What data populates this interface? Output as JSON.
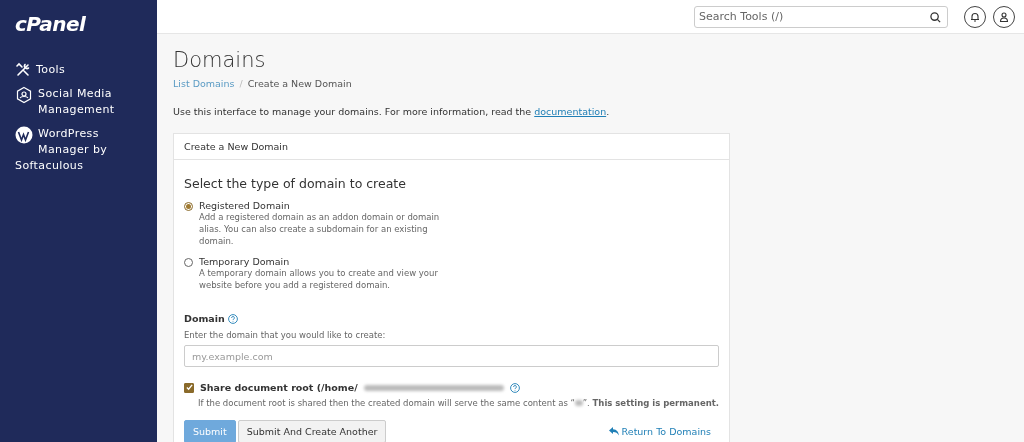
{
  "sidebar": {
    "logo": "cPanel",
    "items": [
      {
        "kind": "tools",
        "label": "Tools"
      },
      {
        "kind": "social",
        "label": "Social Media Management"
      },
      {
        "kind": "wordpress",
        "label": "WordPress Manager by Softaculous"
      }
    ]
  },
  "topbar": {
    "search": {
      "placeholder": "Search Tools (/)"
    }
  },
  "page": {
    "title": "Domains",
    "breadcrumb_separator": "/",
    "breadcrumb": [
      {
        "label": "List Domains",
        "link": true
      },
      {
        "label": "Create a New Domain",
        "link": false
      }
    ],
    "intro": "Use this interface to manage your domains. For more information, read the ",
    "intro_link": "documentation",
    "intro_end": "."
  },
  "panel": {
    "header": "Create a New Domain",
    "heading": "Select the type of domain to create",
    "options": [
      {
        "label": "Registered Domain",
        "description": "Add a registered domain as an addon domain or domain alias. You can also create a subdomain for an existing domain.",
        "selected": true
      },
      {
        "label": "Temporary Domain",
        "description": "A temporary domain allows you to create and view your website before you add a registered domain.",
        "selected": false
      }
    ],
    "domain_label": "Domain",
    "domain_hint": "Enter the domain that you would like to create:",
    "domain_field": {
      "placeholder": "my.example.com"
    },
    "share": {
      "label": "Share document root (/home/",
      "checked": true,
      "help": "If the document root is shared then the created domain will serve the same content as “",
      "help_end": "”. **This setting is permanent.**"
    },
    "buttons": [
      {
        "kind": "primary",
        "label": "Submit"
      },
      {
        "kind": "secondary",
        "label": "Submit And Create Another"
      }
    ],
    "return_link": "Return To Domains"
  }
}
